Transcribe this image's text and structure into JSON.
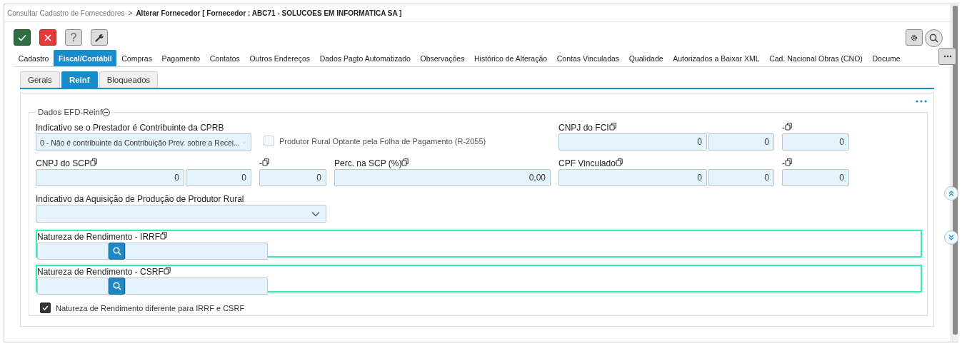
{
  "breadcrumb": {
    "parent": "Consultar Cadastro de Fornecedores",
    "separator": ">",
    "current": "Alterar Fornecedor [ Fornecedor : ABC71 - SOLUCOES EM INFORMATICA SA ]"
  },
  "toolbar": [
    {
      "kind": "confirm"
    },
    {
      "kind": "cancel"
    },
    {
      "kind": "help",
      "label": "?"
    },
    {
      "kind": "tools"
    }
  ],
  "tools": [
    {
      "kind": "settings"
    },
    {
      "kind": "search"
    }
  ],
  "tabs": [
    {
      "label": "Cadastro",
      "selected": false
    },
    {
      "label": "Fiscal/Contábil",
      "selected": true
    },
    {
      "label": "Compras",
      "selected": false
    },
    {
      "label": "Pagamento",
      "selected": false
    },
    {
      "label": "Contatos",
      "selected": false
    },
    {
      "label": "Outros Endereços",
      "selected": false
    },
    {
      "label": "Dados Pagto Automatizado",
      "selected": false
    },
    {
      "label": "Observações",
      "selected": false
    },
    {
      "label": "Histórico de Alteração",
      "selected": false
    },
    {
      "label": "Contas Vinculadas",
      "selected": false
    },
    {
      "label": "Qualidade",
      "selected": false
    },
    {
      "label": "Autorizados a Baixar XML",
      "selected": false
    },
    {
      "label": "Cad. Nacional Obras (CNO)",
      "selected": false
    },
    {
      "label": "Docume",
      "selected": false
    }
  ],
  "subtabs": [
    {
      "label": "Gerais",
      "selected": false
    },
    {
      "label": "Reinf",
      "selected": true
    },
    {
      "label": "Bloqueados",
      "selected": false
    }
  ],
  "section": {
    "title": "Dados EFD-Reinf",
    "expanded": true,
    "fields": [
      {
        "kind": "select",
        "label": "Indicativo se o Prestador é Contribuinte da CPRB",
        "copyable": false,
        "value": "0 - Não é contribuinte da Contribuição Prev. sobre a Recei..."
      },
      {
        "kind": "checkbox",
        "label": "Produtor Rural Optante pela Folha de Pagamento (R-2055)",
        "checked": false,
        "disabled": true
      },
      {
        "kind": "number",
        "label": "CNPJ do FCI",
        "copyable": true,
        "values": [
          "0",
          "0"
        ]
      },
      {
        "kind": "number",
        "label": "-",
        "copyable": true,
        "values": [
          "0"
        ]
      },
      {
        "kind": "number",
        "label": "CNPJ do SCP",
        "copyable": true,
        "values": [
          "0",
          "0"
        ]
      },
      {
        "kind": "number",
        "label": "-",
        "copyable": true,
        "values": [
          "0"
        ]
      },
      {
        "kind": "number",
        "label": "Perc. na SCP (%)",
        "copyable": true,
        "values": [
          "0,00"
        ]
      },
      {
        "kind": "number",
        "label": "CPF Vinculado",
        "copyable": true,
        "values": [
          "0",
          "0"
        ]
      },
      {
        "kind": "number",
        "label": "-",
        "copyable": true,
        "values": [
          "0"
        ]
      },
      {
        "kind": "select",
        "label": "Indicativo da Aquisição de Produção de Produtor Rural",
        "copyable": false
      },
      {
        "kind": "lookup",
        "label": "Natureza de Rendimento - IRRF",
        "copyable": true,
        "highlighted": true
      },
      {
        "kind": "lookup",
        "label": "Natureza de Rendimento - CSRF",
        "copyable": true,
        "highlighted": true
      },
      {
        "kind": "checkbox",
        "label": "Natureza de Rendimento diferente para IRRF e CSRF",
        "checked": true,
        "disabled": false
      }
    ]
  }
}
